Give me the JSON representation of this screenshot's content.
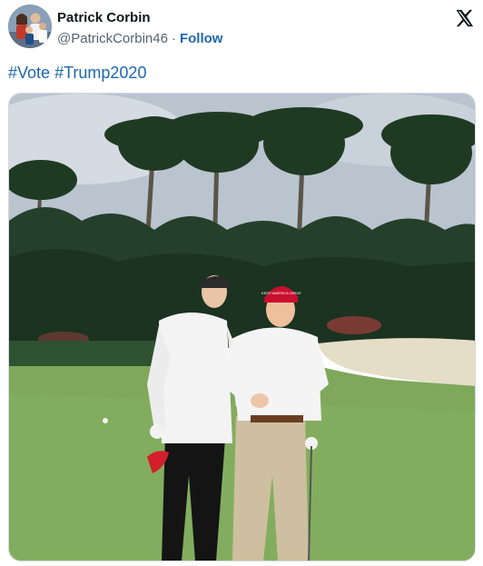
{
  "author": {
    "display_name": "Patrick Corbin",
    "handle": "@PatrickCorbin46",
    "separator": "·",
    "follow_label": "Follow",
    "avatar_icon": "profile-photo"
  },
  "platform_icon": "x-logo-icon",
  "tweet": {
    "hashtags": [
      "#Vote",
      "#Trump2020"
    ]
  },
  "media": {
    "kind": "photo",
    "hat_text": "KEEP AMERICA GREAT"
  },
  "colors": {
    "link": "#1d67b0",
    "text": "#0f1419",
    "secondary": "#536471",
    "border": "#cfd9de"
  }
}
